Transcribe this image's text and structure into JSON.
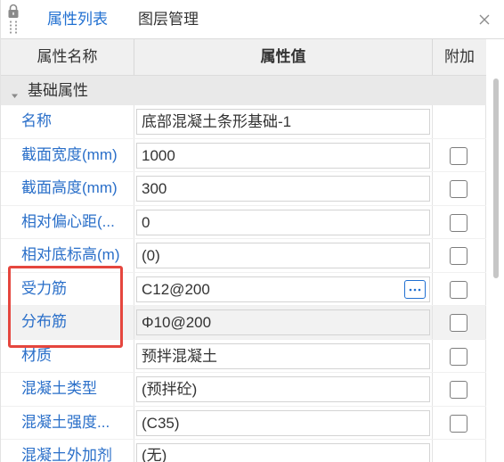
{
  "tabs": [
    {
      "label": "属性列表",
      "active": true
    },
    {
      "label": "图层管理",
      "active": false
    }
  ],
  "header": {
    "name": "属性名称",
    "value": "属性值",
    "extra": "附加"
  },
  "group": {
    "label": "基础属性",
    "expanded": true
  },
  "rows": [
    {
      "name": "名称",
      "value": "底部混凝土条形基础-1",
      "has_checkbox": false,
      "checked": false,
      "has_more_button": false,
      "selected": false
    },
    {
      "name": "截面宽度(mm)",
      "value": "1000",
      "has_checkbox": true,
      "checked": false,
      "has_more_button": false,
      "selected": false
    },
    {
      "name": "截面高度(mm)",
      "value": "300",
      "has_checkbox": true,
      "checked": false,
      "has_more_button": false,
      "selected": false
    },
    {
      "name": "相对偏心距(...",
      "value": "0",
      "has_checkbox": true,
      "checked": false,
      "has_more_button": false,
      "selected": false
    },
    {
      "name": "相对底标高(m)",
      "value": "(0)",
      "has_checkbox": true,
      "checked": false,
      "has_more_button": false,
      "selected": false
    },
    {
      "name": "受力筋",
      "value": "C12@200",
      "has_checkbox": true,
      "checked": false,
      "has_more_button": true,
      "selected": false
    },
    {
      "name": "分布筋",
      "value": "Φ10@200",
      "has_checkbox": true,
      "checked": false,
      "has_more_button": false,
      "selected": true
    },
    {
      "name": "材质",
      "value": "预拌混凝土",
      "has_checkbox": true,
      "checked": false,
      "has_more_button": false,
      "selected": false
    },
    {
      "name": "混凝土类型",
      "value": "(预拌砼)",
      "has_checkbox": true,
      "checked": false,
      "has_more_button": false,
      "selected": false
    },
    {
      "name": "混凝土强度...",
      "value": "(C35)",
      "has_checkbox": true,
      "checked": false,
      "has_more_button": false,
      "selected": false
    },
    {
      "name": "混凝土外加剂",
      "value": "(无)",
      "has_checkbox": false,
      "checked": false,
      "has_more_button": false,
      "selected": false
    }
  ],
  "highlight": {
    "row_indices": [
      5,
      6
    ],
    "color": "#e5463e"
  },
  "icons": {
    "lock": "lock-icon",
    "grip": "drag-handle-icon",
    "close": "close-icon",
    "group_toggle": "caret-down-icon",
    "more": "ellipsis-icon"
  },
  "colors": {
    "accent": "#1f6fd1",
    "property_name": "#2a6fc9",
    "highlight": "#e5463e",
    "header_bg": "#f0f0f0",
    "group_bg": "#e9e9e9"
  }
}
